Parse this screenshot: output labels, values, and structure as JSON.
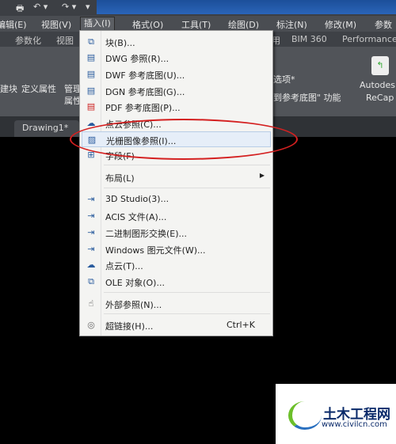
{
  "menubar": {
    "items": [
      "编辑(E)",
      "视图(V)",
      "插入(I)",
      "格式(O)",
      "工具(T)",
      "绘图(D)",
      "标注(N)",
      "修改(M)",
      "参数(P)"
    ]
  },
  "ribbon_tabs": [
    "参数化",
    "视图",
    "用",
    "BIM 360",
    "Performance"
  ],
  "ribbon": {
    "block": "建块",
    "define_attr": "定义属性",
    "manage": "管理",
    "attr": "属性",
    "options": "选项*",
    "ref": "到参考底图\" 功能",
    "recap1": "Autodesk",
    "recap2": "ReCap"
  },
  "doc_tab": "Drawing1*",
  "menu": {
    "items": [
      {
        "label": "块(B)...",
        "icon": "block-icon"
      },
      {
        "label": "DWG 参照(R)...",
        "icon": "dwg-icon"
      },
      {
        "label": "DWF 参考底图(U)...",
        "icon": "dwf-icon"
      },
      {
        "label": "DGN 参考底图(G)...",
        "icon": "dgn-icon"
      },
      {
        "label": "PDF 参考底图(P)...",
        "icon": "pdf-icon"
      },
      {
        "label": "点云参照(C)...",
        "icon": "point-cloud-icon"
      },
      {
        "label": "光栅图像参照(I)...",
        "icon": "raster-image-icon",
        "highlighted": true
      },
      {
        "label": "字段(F)",
        "icon": "field-icon"
      },
      {
        "label": "布局(L)",
        "submenu": true
      },
      {
        "label": "3D Studio(3)...",
        "icon": "3ds-icon"
      },
      {
        "label": "ACIS 文件(A)...",
        "icon": "acis-icon"
      },
      {
        "label": "二进制图形交换(E)...",
        "icon": "dxb-icon"
      },
      {
        "label": "Windows 图元文件(W)...",
        "icon": "wmf-icon"
      },
      {
        "label": "点云(T)...",
        "icon": "point-cloud-icon"
      },
      {
        "label": "OLE 对象(O)...",
        "icon": "ole-icon"
      },
      {
        "label": "外部参照(N)...",
        "icon": "xref-icon"
      },
      {
        "label": "超链接(H)...",
        "icon": "hyperlink-icon",
        "shortcut": "Ctrl+K"
      }
    ]
  },
  "watermark": {
    "name": "土木工程网",
    "url": "www.civilcn.com"
  }
}
